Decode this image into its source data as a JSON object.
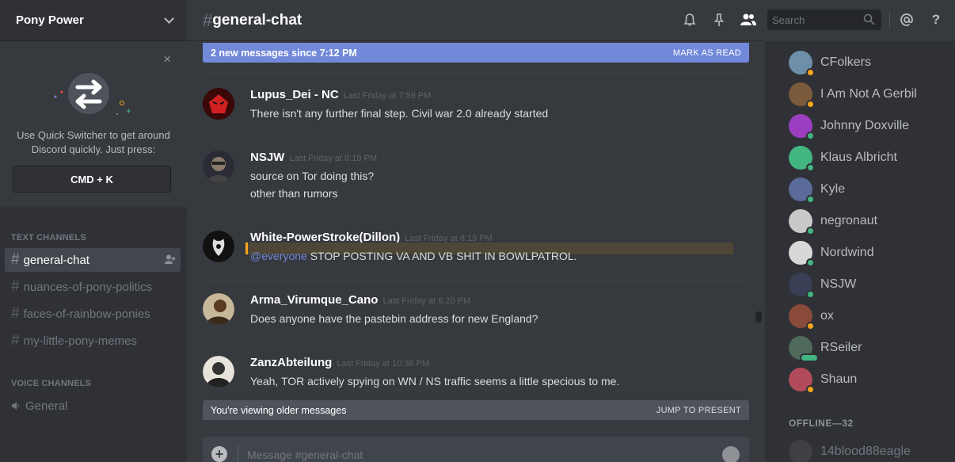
{
  "server": {
    "name": "Pony Power"
  },
  "quick_switcher": {
    "text": "Use Quick Switcher to get around Discord quickly. Just press:",
    "shortcut": "CMD + K",
    "close": "×"
  },
  "channels": {
    "text_header": "TEXT CHANNELS",
    "text": [
      {
        "name": "general-chat",
        "active": true
      },
      {
        "name": "nuances-of-pony-politics",
        "active": false
      },
      {
        "name": "faces-of-rainbow-ponies",
        "active": false
      },
      {
        "name": "my-little-pony-memes",
        "active": false
      }
    ],
    "voice_header": "VOICE CHANNELS",
    "voice": [
      {
        "name": "General"
      }
    ]
  },
  "chat": {
    "channel": "general-chat",
    "search_placeholder": "Search",
    "new_messages": "2 new messages since 7:12 PM",
    "mark_read": "MARK AS READ",
    "older_notice": "You're viewing older messages",
    "jump_present": "JUMP TO PRESENT",
    "composer_placeholder": "Message #general-chat",
    "messages": [
      {
        "author": "Lupus_Dei - NC",
        "timestamp": "Last Friday at 7:59 PM",
        "lines": [
          "There isn't any further final step. Civil war 2.0 already started"
        ]
      },
      {
        "author": "NSJW",
        "timestamp": "Last Friday at 8:19 PM",
        "lines": [
          "source on Tor doing this?",
          "other than rumors"
        ]
      },
      {
        "author": "White-PowerStroke(Dillon)",
        "timestamp": "Last Friday at 8:19 PM",
        "mention": "@everyone",
        "lines": [
          "STOP POSTING VA AND VB SHIT IN BOWLPATROL."
        ]
      },
      {
        "author": "Arma_Virumque_Cano",
        "timestamp": "Last Friday at 8:20 PM",
        "lines": [
          "Does anyone have the pastebin address for new England?"
        ]
      },
      {
        "author": "ZanzAbteilung",
        "timestamp": "Last Friday at 10:38 PM",
        "lines": [
          "Yeah, TOR actively spying on WN / NS traffic seems a little specious to me."
        ]
      }
    ]
  },
  "members": {
    "online": [
      {
        "name": "CFolkers",
        "status": "idle",
        "avatar_color": "#6d8fa8"
      },
      {
        "name": "I Am Not A Gerbil",
        "status": "idle",
        "avatar_color": "#7a5a3a"
      },
      {
        "name": "Johnny Doxville",
        "status": "online",
        "avatar_color": "#9b3fc0"
      },
      {
        "name": "Klaus Albricht",
        "status": "online",
        "avatar_color": "#43b581"
      },
      {
        "name": "Kyle",
        "status": "online",
        "avatar_color": "#5a6a9a"
      },
      {
        "name": "negronaut",
        "status": "online",
        "avatar_color": "#c9c9c9"
      },
      {
        "name": "Nordwind",
        "status": "online",
        "avatar_color": "#d8d8d8"
      },
      {
        "name": "NSJW",
        "status": "online",
        "avatar_color": "#3a3f55"
      },
      {
        "name": "ox",
        "status": "idle",
        "avatar_color": "#8a4a3a"
      },
      {
        "name": "RSeiler",
        "status": "typing",
        "avatar_color": "#4f6a5a"
      },
      {
        "name": "Shaun",
        "status": "idle",
        "avatar_color": "#b14a5a"
      }
    ],
    "offline_header": "OFFLINE—32",
    "offline": [
      {
        "name": "14blood88eagle",
        "avatar_color": "#555555"
      }
    ]
  },
  "colors": {
    "accent": "#7289da",
    "online": "#43b581",
    "idle": "#faa61a",
    "mention": "#faa61a"
  }
}
